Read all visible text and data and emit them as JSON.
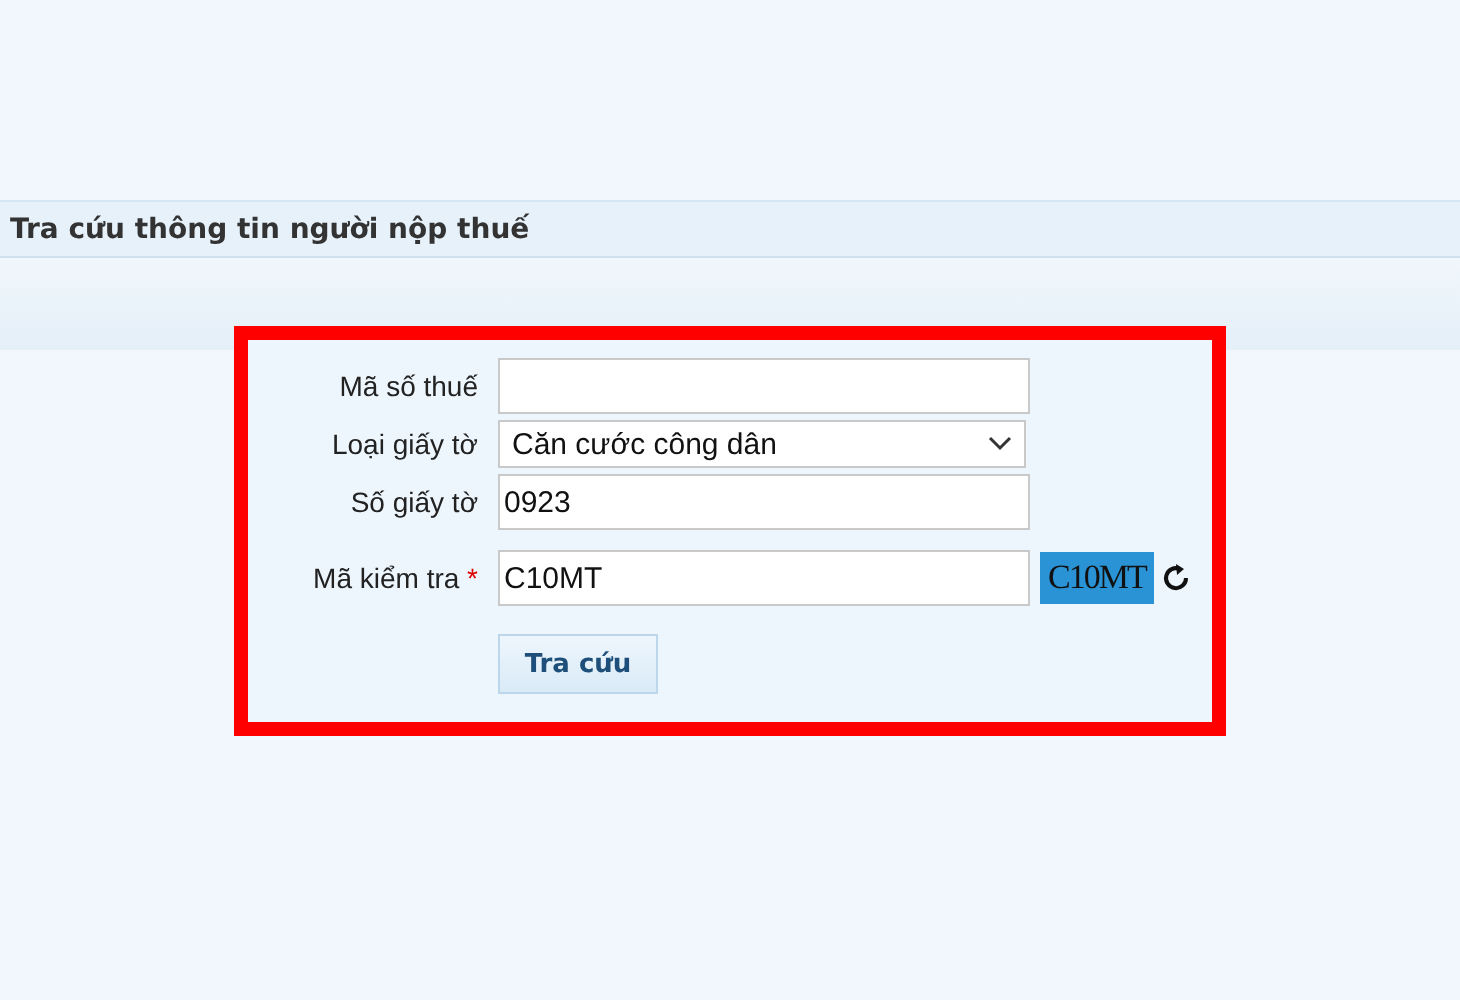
{
  "header": {
    "title": "Tra cứu thông tin người nộp thuế"
  },
  "form": {
    "fields": [
      {
        "kind": "text",
        "label": "Mã số thuế"
      },
      {
        "kind": "select",
        "label": "Loại giấy tờ",
        "value": "Căn cước công dân"
      },
      {
        "kind": "text",
        "label": "Số giấy tờ",
        "value": "0923"
      },
      {
        "kind": "captcha",
        "label": "Mã kiểm tra",
        "value": "C10MT",
        "required_mark": "*",
        "captcha_text": "C10MT"
      }
    ],
    "submit": "Tra cứu"
  }
}
